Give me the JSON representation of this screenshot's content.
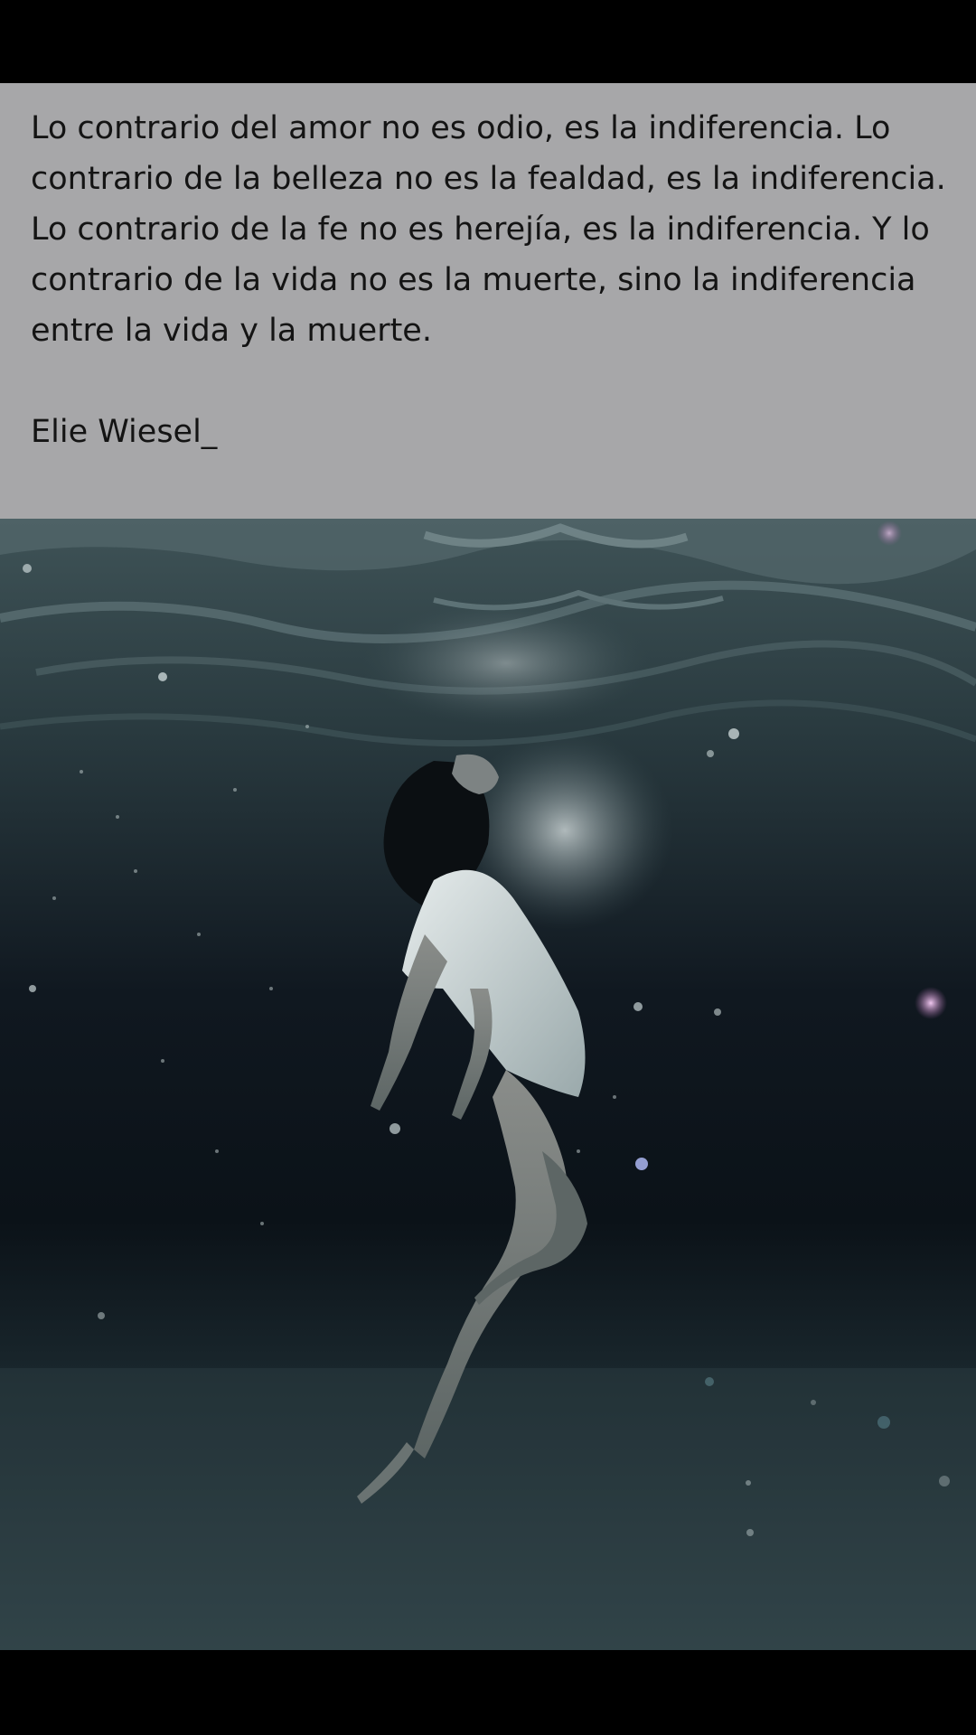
{
  "quote": {
    "text": "Lo contrario del amor no es odio, es la indiferencia. Lo contrario de la belleza no es la fealdad, es la indiferencia. Lo contrario de la fe no es herejía, es la indiferencia. Y lo contrario de la vida no es la muerte, sino la indiferencia entre la vida y la muerte.",
    "author": "Elie Wiesel_"
  },
  "colors": {
    "card_background": "#a7a7a9",
    "text": "#141414",
    "frame": "#000000",
    "water_surface": "#3f5357",
    "water_deep": "#0d151b",
    "seabed": "#2f4045"
  }
}
